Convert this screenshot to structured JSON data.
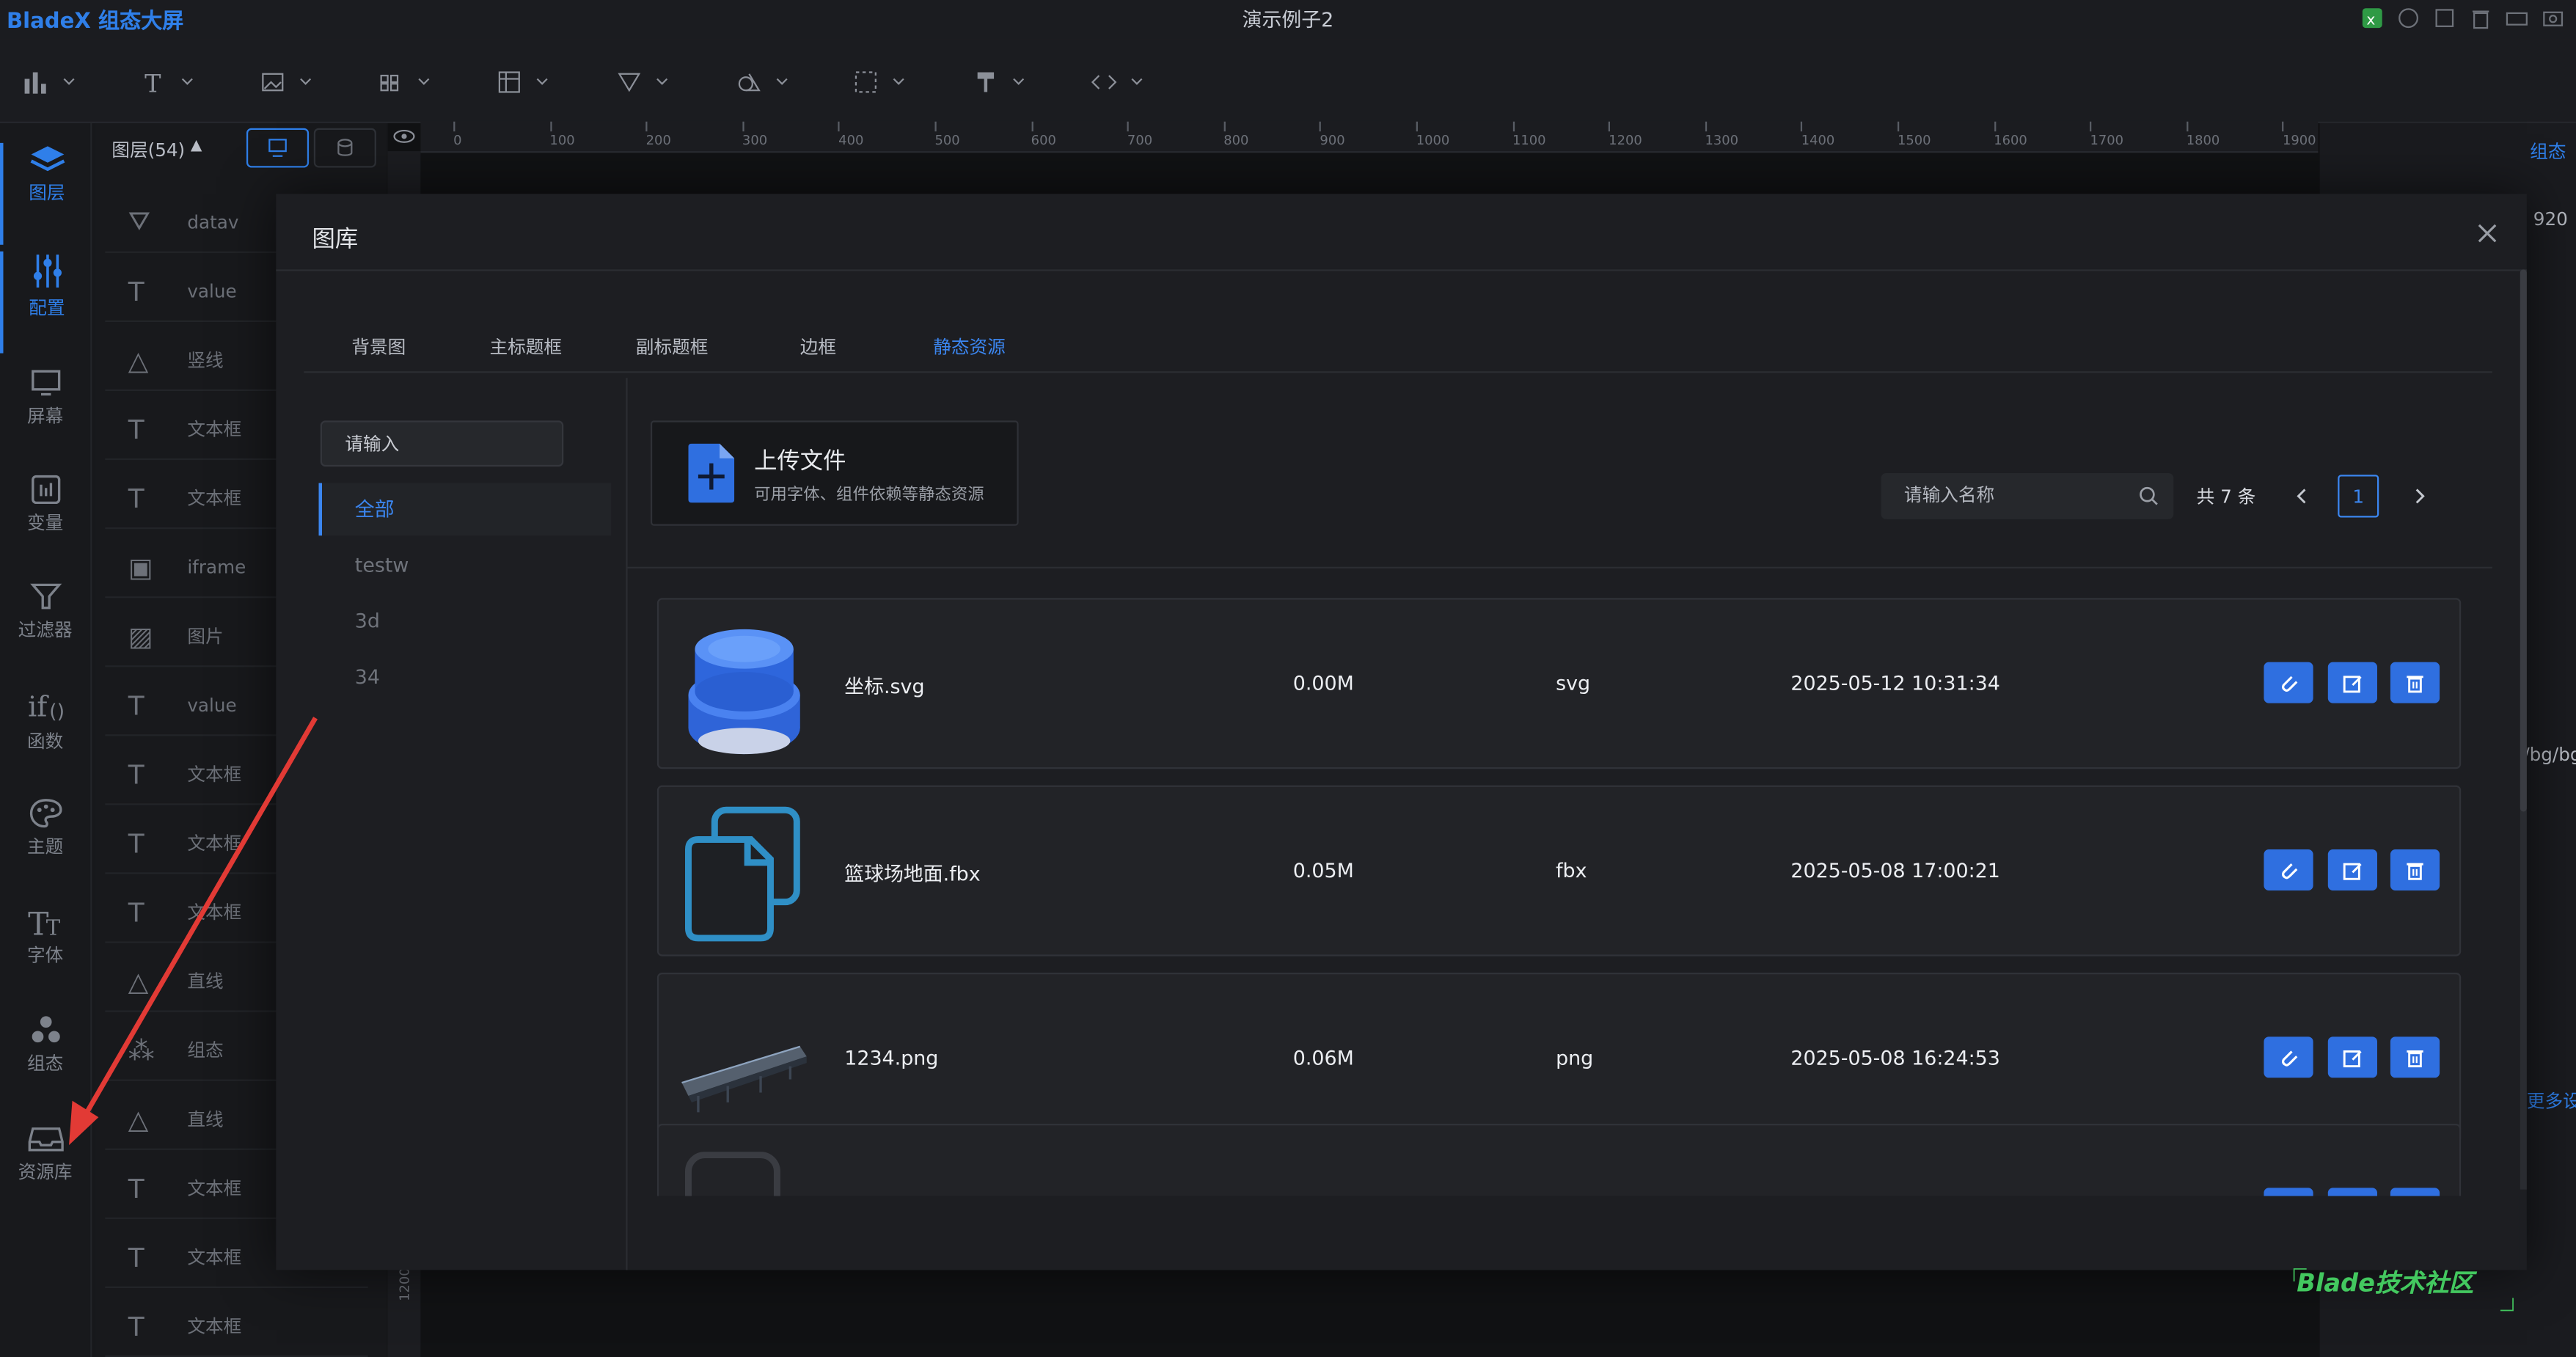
{
  "app": {
    "logo": "BladeX 组态大屏",
    "window_title": "演示例子2"
  },
  "nav": [
    {
      "label": "图层",
      "icon": "layers-icon",
      "active": true
    },
    {
      "label": "配置",
      "icon": "sliders-icon",
      "active": true
    },
    {
      "label": "屏幕",
      "icon": "monitor-icon"
    },
    {
      "label": "变量",
      "icon": "variable-icon"
    },
    {
      "label": "过滤器",
      "icon": "filter-icon"
    },
    {
      "label": "函数",
      "icon": "function-icon"
    },
    {
      "label": "主题",
      "icon": "palette-icon"
    },
    {
      "label": "字体",
      "icon": "font-icon"
    },
    {
      "label": "组态",
      "icon": "component-icon"
    },
    {
      "label": "资源库",
      "icon": "inbox-icon"
    }
  ],
  "layers": {
    "title": "图层(54)",
    "items": [
      {
        "icon": "⛛",
        "label": "datav"
      },
      {
        "icon": "T",
        "label": "value"
      },
      {
        "icon": "△",
        "label": "竖线"
      },
      {
        "icon": "T",
        "label": "文本框"
      },
      {
        "icon": "T",
        "label": "文本框"
      },
      {
        "icon": "▣",
        "label": "iframe"
      },
      {
        "icon": "▨",
        "label": "图片"
      },
      {
        "icon": "T",
        "label": "value"
      },
      {
        "icon": "T",
        "label": "文本框"
      },
      {
        "icon": "T",
        "label": "文本框"
      },
      {
        "icon": "T",
        "label": "文本框"
      },
      {
        "icon": "△",
        "label": "直线"
      },
      {
        "icon": "⁂",
        "label": "组态"
      },
      {
        "icon": "△",
        "label": "直线"
      },
      {
        "icon": "T",
        "label": "文本框"
      },
      {
        "icon": "T",
        "label": "文本框"
      },
      {
        "icon": "T",
        "label": "文本框"
      }
    ]
  },
  "ruler": {
    "ticks": [
      "0",
      "100",
      "200",
      "300",
      "400",
      "500",
      "600",
      "700",
      "800",
      "900",
      "1000",
      "1100",
      "1200",
      "1300",
      "1400",
      "1500",
      "1600",
      "1700",
      "1800",
      "1900"
    ],
    "vertical_label": "1200"
  },
  "right_panel": {
    "tab": "组态",
    "value_920": "920",
    "bg_text": "/bg/bg",
    "more": "更多设"
  },
  "modal": {
    "title": "图库",
    "tabs": [
      {
        "label": "背景图"
      },
      {
        "label": "主标题框"
      },
      {
        "label": "副标题框"
      },
      {
        "label": "边框"
      },
      {
        "label": "静态资源",
        "active": true
      }
    ],
    "category_search_placeholder": "请输入",
    "categories": [
      {
        "label": "全部",
        "active": true
      },
      {
        "label": "testw"
      },
      {
        "label": "3d"
      },
      {
        "label": "34"
      }
    ],
    "upload": {
      "title": "上传文件",
      "subtitle": "可用字体、组件依赖等静态资源"
    },
    "name_search_placeholder": "请输入名称",
    "total": "共 7 条",
    "page": "1",
    "files": [
      {
        "name": "坐标.svg",
        "size": "0.00M",
        "type": "svg",
        "date": "2025-05-12 10:31:34",
        "thumb": "blue-marker"
      },
      {
        "name": "篮球场地面.fbx",
        "size": "0.05M",
        "type": "fbx",
        "date": "2025-05-08 17:00:21",
        "thumb": "file-copy-icon"
      },
      {
        "name": "1234.png",
        "size": "0.06M",
        "type": "png",
        "date": "2025-05-08 16:24:53",
        "thumb": "conveyor-image"
      }
    ]
  },
  "watermark": "Blade技术社区",
  "colors": {
    "accent": "#2f7fe9",
    "button": "#2f6fe0",
    "watermark": "#43c85f",
    "annotation_arrow": "#e23a35"
  }
}
